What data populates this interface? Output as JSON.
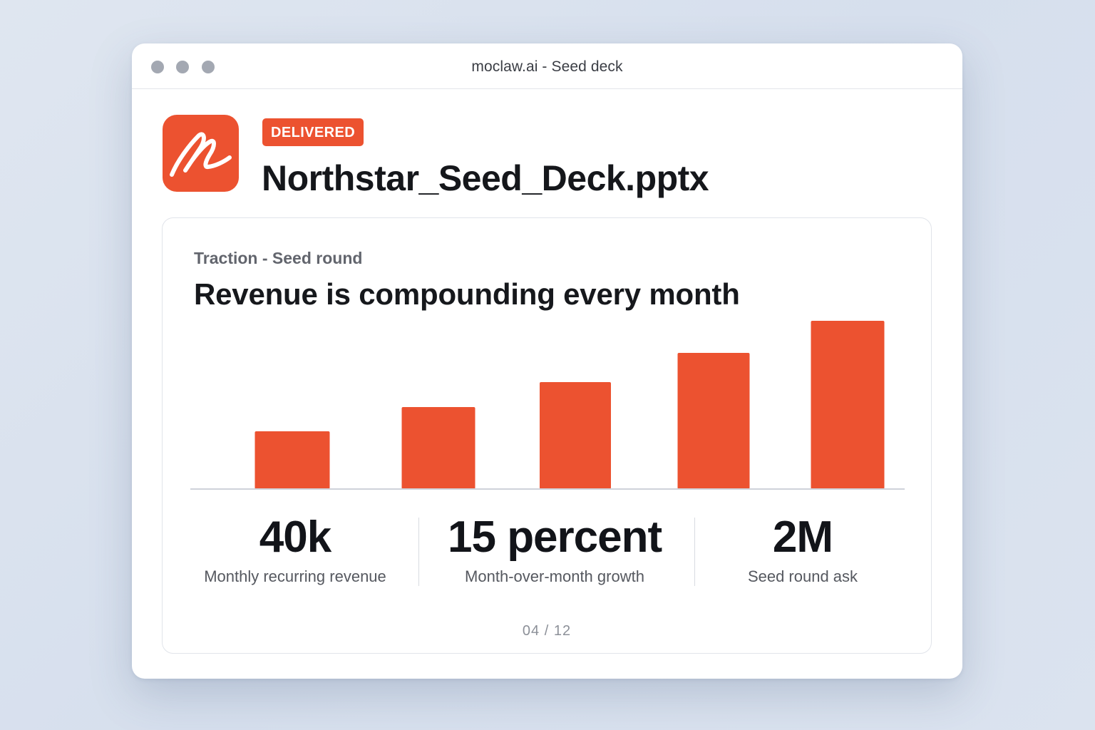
{
  "window": {
    "title": "moclaw.ai - Seed deck"
  },
  "file": {
    "status_badge": "DELIVERED",
    "name": "Northstar_Seed_Deck.pptx",
    "icon": "signature-logo-icon"
  },
  "slide": {
    "eyebrow": "Traction - Seed round",
    "headline": "Revenue is compounding every month",
    "page_current": "04",
    "page_separator": "/",
    "page_total": "12"
  },
  "chart_data": {
    "type": "bar",
    "categories": [
      "",
      "",
      "",
      "",
      ""
    ],
    "values": [
      81,
      115,
      150,
      191,
      236
    ],
    "ylim": [
      0,
      236
    ],
    "grid": false,
    "color": "#ec5230"
  },
  "stats": [
    {
      "value": "40k",
      "label": "Monthly recurring revenue"
    },
    {
      "value": "15 percent",
      "label": "Month-over-month growth"
    },
    {
      "value": "2M",
      "label": "Seed round ask"
    }
  ],
  "colors": {
    "accent": "#ec5230",
    "text_primary": "#15171b",
    "text_secondary": "#55585f"
  }
}
